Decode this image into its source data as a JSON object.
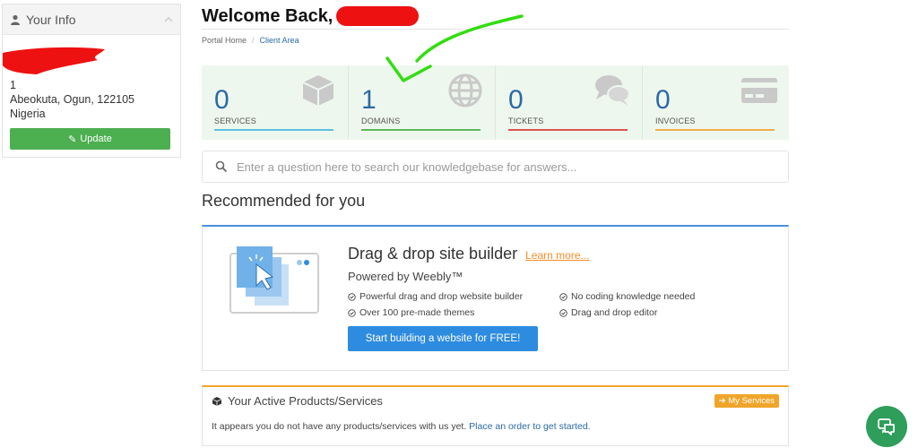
{
  "sidebar": {
    "title": "Your Info",
    "address_line1": "1",
    "address_line2": "Abeokuta, Ogun, 122105",
    "country": "Nigeria",
    "update_label": "Update"
  },
  "header": {
    "welcome": "Welcome Back,",
    "breadcrumb": {
      "home": "Portal Home",
      "current": "Client Area"
    }
  },
  "stats": [
    {
      "value": "0",
      "label": "SERVICES",
      "color": "#5bc0de",
      "icon": "box-icon"
    },
    {
      "value": "1",
      "label": "DOMAINS",
      "color": "#5cb85c",
      "icon": "globe-icon"
    },
    {
      "value": "0",
      "label": "TICKETS",
      "color": "#d9534f",
      "icon": "chat-icon"
    },
    {
      "value": "0",
      "label": "INVOICES",
      "color": "#f0ad4e",
      "icon": "credit-card-icon"
    }
  ],
  "search": {
    "placeholder": "Enter a question here to search our knowledgebase for answers..."
  },
  "recommended": {
    "title": "Recommended for you",
    "promo_title": "Drag & drop site builder",
    "learn_more": "Learn more...",
    "powered_by": "Powered by Weebly™",
    "features": [
      "Powerful drag and drop website builder",
      "Over 100 pre-made themes",
      "No coding knowledge needed",
      "Drag and drop editor"
    ],
    "cta": "Start building a website for FREE!"
  },
  "products": {
    "title": "Your Active Products/Services",
    "button": "My Services",
    "empty_text": "It appears you do not have any products/services with us yet.",
    "empty_link": "Place an order to get started."
  },
  "colors": {
    "accent": "#2a6aa6",
    "success": "#4caf50",
    "annotation": "#33dd11",
    "redaction": "#ee1111"
  }
}
